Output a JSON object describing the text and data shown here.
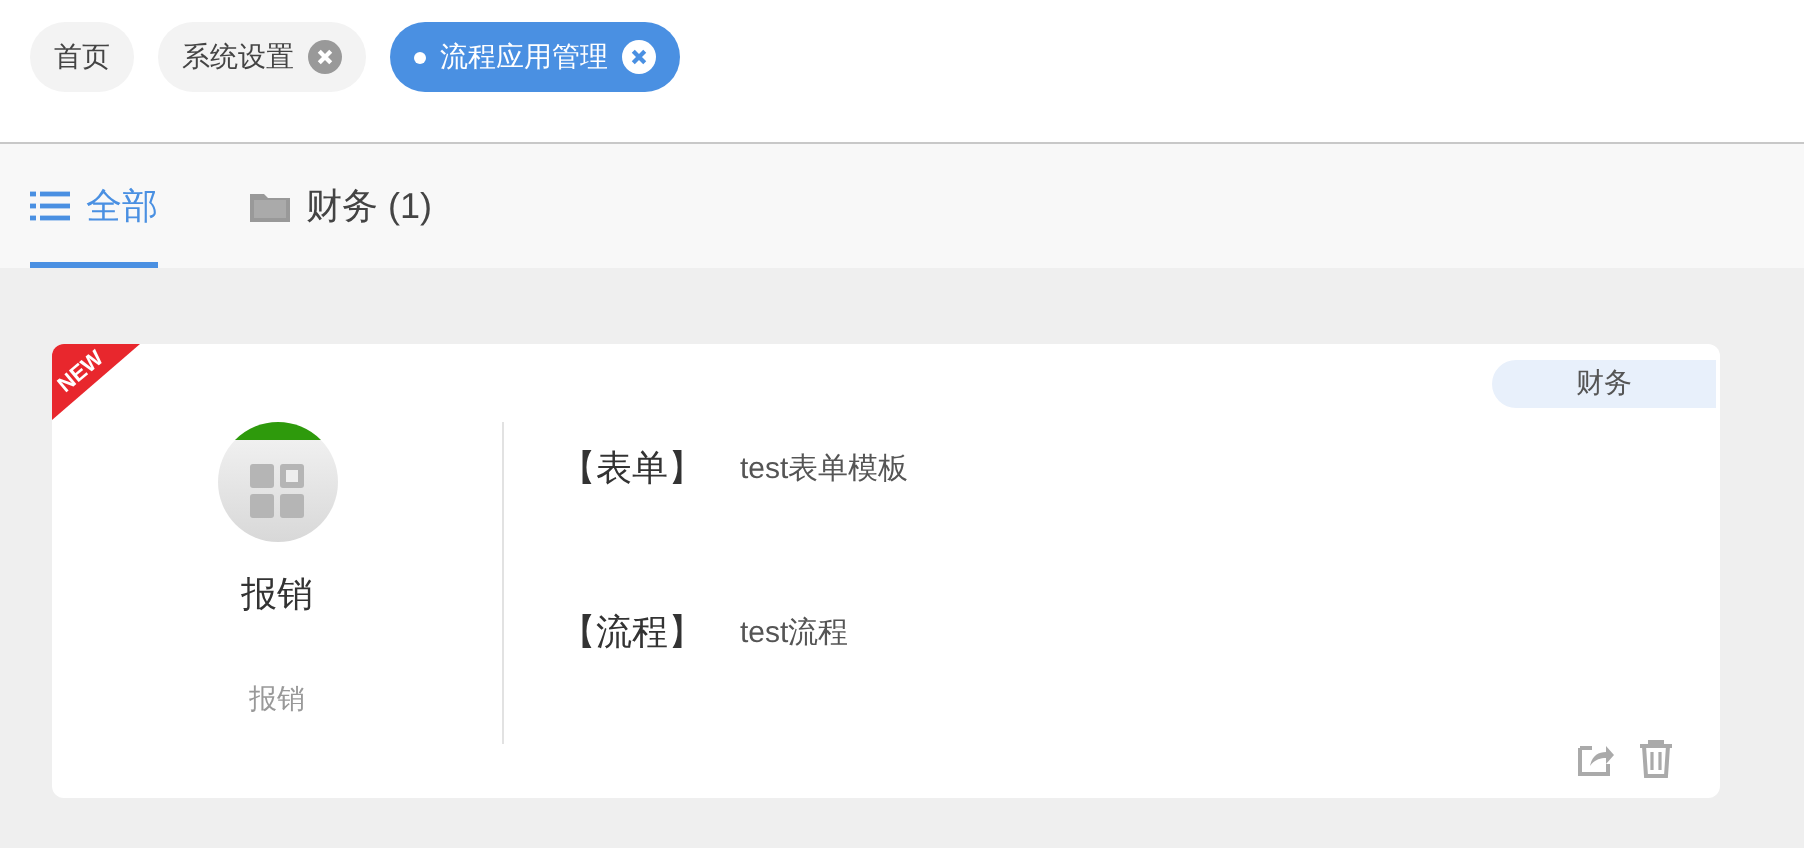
{
  "tags": [
    {
      "label": "首页",
      "selected": false,
      "closable": false
    },
    {
      "label": "系统设置",
      "selected": false,
      "closable": true
    },
    {
      "label": "流程应用管理",
      "selected": true,
      "closable": true
    }
  ],
  "category_tabs": [
    {
      "label": "全部",
      "selected": true,
      "kind": "list"
    },
    {
      "label": "财务 (1)",
      "selected": false,
      "kind": "folder"
    }
  ],
  "cards": [
    {
      "is_new": true,
      "badge": "NEW",
      "name": "报销",
      "subtitle": "报销",
      "category": "财务",
      "rows": [
        {
          "label": "【表单】",
          "value": "test表单模板"
        },
        {
          "label": "【流程】",
          "value": "test流程"
        }
      ]
    }
  ]
}
